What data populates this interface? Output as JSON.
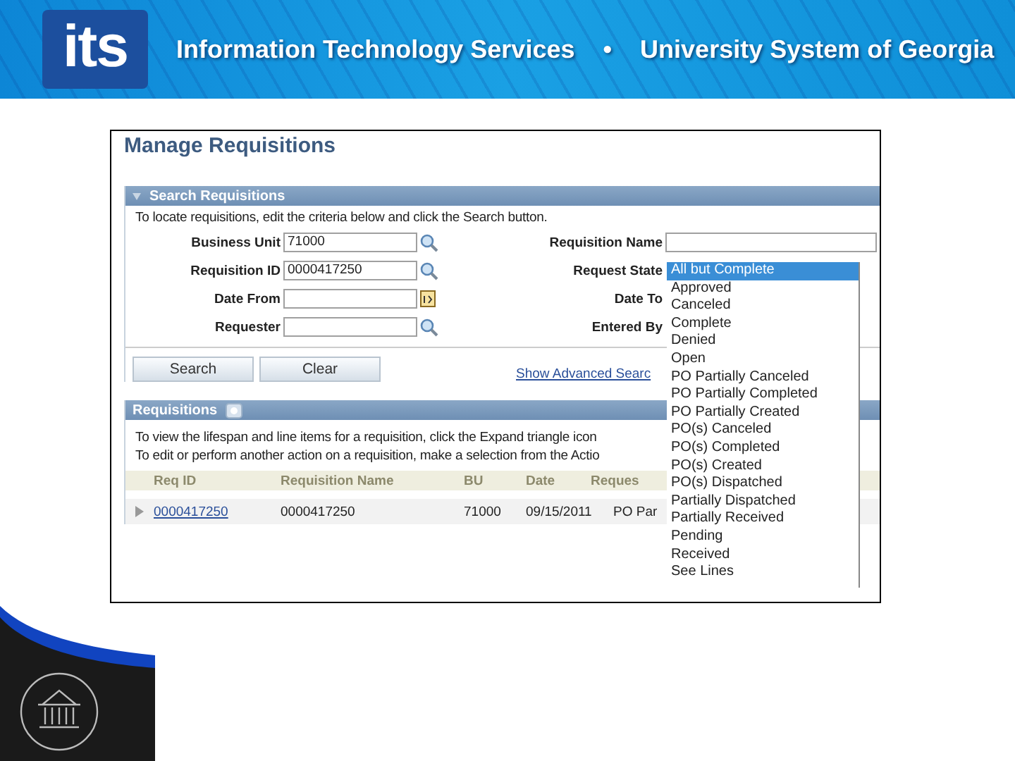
{
  "header": {
    "logo": "its",
    "title": "Information Technology Services",
    "separator": "•",
    "subtitle": "University System of Georgia"
  },
  "screen": {
    "page_title": "Manage Requisitions",
    "search_panel": {
      "title": "Search Requisitions",
      "instructions": "To locate requisitions, edit the criteria below and click the Search button.",
      "left_fields": [
        {
          "label": "Business Unit",
          "value": "71000",
          "kind": "lookup"
        },
        {
          "label": "Requisition ID",
          "value": "0000417250",
          "kind": "lookup"
        },
        {
          "label": "Date From",
          "kind": "date"
        },
        {
          "label": "Requester",
          "kind": "lookup"
        }
      ],
      "right_fields": [
        {
          "label": "Requisition Name",
          "kind": "text"
        },
        {
          "label": "Request State",
          "kind": "hidden"
        },
        {
          "label": "Date To",
          "kind": "hidden"
        },
        {
          "label": "Entered By",
          "kind": "hidden"
        }
      ],
      "buttons": [
        "Search",
        "Clear"
      ],
      "advanced_link": "Show Advanced Searc"
    },
    "requisitions_panel": {
      "title": "Requisitions",
      "instructions": [
        "To view the lifespan and line items for a requisition, click the Expand triangle icon",
        "To edit or perform another action on a requisition, make a selection from the Actio"
      ],
      "columns": [
        "Req ID",
        "Requisition Name",
        "BU",
        "Date",
        "Reques"
      ],
      "rows": [
        {
          "req_id": "0000417250",
          "name": "0000417250",
          "bu": "71000",
          "date": "09/15/2011",
          "state": "PO Par",
          "expanded": false
        }
      ]
    },
    "request_state_dropdown": [
      {
        "label": "All but Complete",
        "selected": true
      },
      {
        "label": "Approved",
        "selected": false
      },
      {
        "label": "Canceled",
        "selected": false
      },
      {
        "label": "Complete",
        "selected": false
      },
      {
        "label": "Denied",
        "selected": false
      },
      {
        "label": "Open",
        "selected": false
      },
      {
        "label": "PO Partially Canceled",
        "selected": false
      },
      {
        "label": "PO Partially Completed",
        "selected": false
      },
      {
        "label": "PO Partially Created",
        "selected": false
      },
      {
        "label": "PO(s) Canceled",
        "selected": false
      },
      {
        "label": "PO(s) Completed",
        "selected": false
      },
      {
        "label": "PO(s) Created",
        "selected": false
      },
      {
        "label": "PO(s) Dispatched",
        "selected": false
      },
      {
        "label": "Partially Dispatched",
        "selected": false
      },
      {
        "label": "Partially Received",
        "selected": false
      },
      {
        "label": "Pending",
        "selected": false
      },
      {
        "label": "Received",
        "selected": false
      },
      {
        "label": "See Lines",
        "selected": false
      }
    ]
  }
}
